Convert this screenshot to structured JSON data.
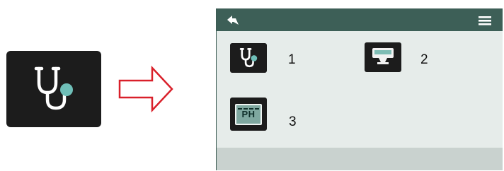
{
  "main_button": {
    "icon": "stethoscope-icon"
  },
  "transition_arrow": {
    "icon": "arrow-right-outline-icon",
    "color": "#d9202a"
  },
  "panel": {
    "header": {
      "back_icon": "back-arrow-icon",
      "menu_icon": "hamburger-menu-icon",
      "color": "#3d5f57"
    },
    "items": [
      {
        "label": "1",
        "icon": "stethoscope-icon"
      },
      {
        "label": "2",
        "icon": "monitor-stand-icon"
      },
      {
        "label": "3",
        "icon": "ph-meter-icon",
        "icon_text": "PH"
      }
    ],
    "background": "#e6ecea",
    "footer_color": "#c9d2cf"
  }
}
